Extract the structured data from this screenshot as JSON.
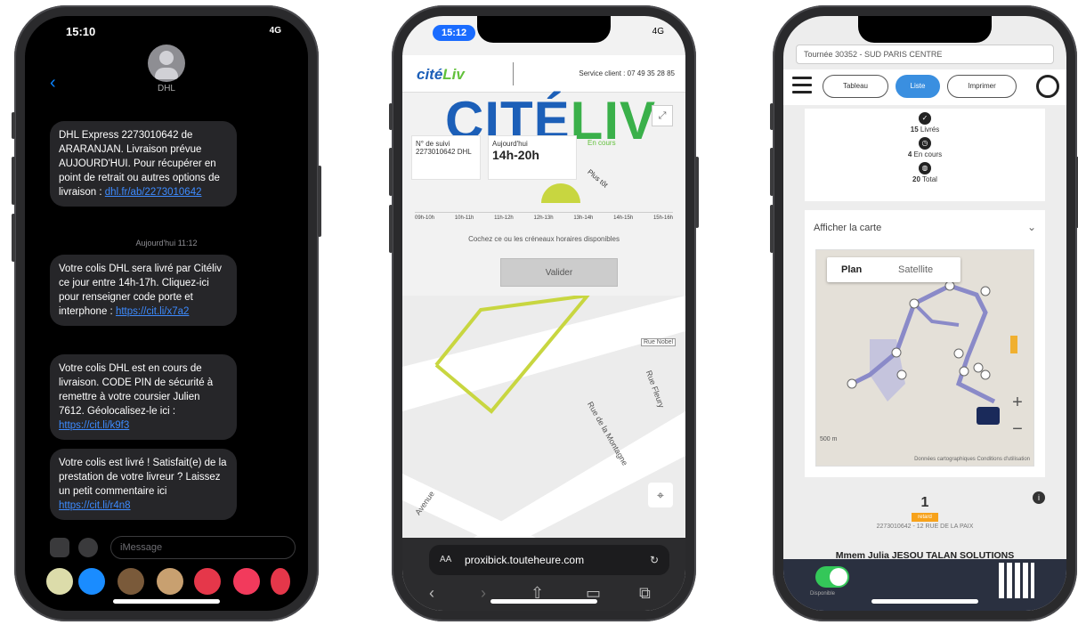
{
  "phone1": {
    "status_time": "15:10",
    "status_right": "4G",
    "contact_name": "DHL",
    "messages": [
      {
        "text": "DHL Express 2273010642 de ARARANJAN. Livraison prévue AUJOURD'HUI. Pour récupérer en point de retrait ou autres options de livraison :",
        "link": "dhl.fr/ab/2273010642"
      },
      {
        "text": "Votre colis DHL sera livré par Citéliv ce jour entre 14h-17h. Cliquez-ici pour renseigner code porte et interphone :",
        "link": "https://cit.li/x7a2"
      },
      {
        "text": "Votre colis DHL est en cours de livraison. CODE PIN de sécurité à remettre à votre coursier Julien 7612. Géolocalisez-le ici :",
        "link": "https://cit.li/k9f3"
      },
      {
        "text": "Votre colis est livré ! Satisfait(e) de la prestation de votre livreur ? Laissez un petit commentaire ici",
        "link": "https://cit.li/r4n8"
      }
    ],
    "timestamp": "Aujourd'hui 11:12",
    "compose_placeholder": "iMessage"
  },
  "phone2": {
    "status_time": "15:12",
    "status_right": "4G",
    "header_logo_a": "cité",
    "header_logo_b": "Liv",
    "service_label": "Service client : 07 49 35 28 85",
    "big_logo_a": "CITÉ",
    "big_logo_b": "LIV",
    "order_label": "N° de suivi",
    "order_value": "2273010642 DHL",
    "eta_label": "Aujourd'hui",
    "eta_value": "14h-20h",
    "status_chip": "En cours",
    "gauge_label": "Plus tôt",
    "hours": [
      "09h-10h",
      "10h-11h",
      "11h-12h",
      "12h-13h",
      "13h-14h",
      "14h-15h",
      "15h-16h"
    ],
    "info_text": "Cochez ce ou les créneaux horaires disponibles",
    "validate_label": "Valider",
    "streets": [
      "Rue de la Montagne",
      "Rue Fleury",
      "Rue Nobel",
      "Avenue"
    ],
    "url": "proxibick.touteheure.com",
    "url_prefix": "AA"
  },
  "phone3": {
    "select_value": "Tournée 30352 - SUD PARIS CENTRE",
    "nav_buttons": [
      "Tableau",
      "Liste",
      "Imprimer"
    ],
    "stats": [
      {
        "count": "15",
        "label": "Livrés"
      },
      {
        "count": "4",
        "label": "En cours"
      },
      {
        "count": "20",
        "label": "Total"
      }
    ],
    "map_title": "Afficher la carte",
    "map_tabs": [
      "Plan",
      "Satellite"
    ],
    "map_scale": "500 m",
    "map_attribution": "Données cartographiques   Conditions d'utilisation",
    "stop_number": "1",
    "stop_tag": "retard",
    "stop_address": "2273010642 - 12 RUE DE LA PAIX",
    "stop_name": "Mmem Julia JESOU TALAN SOLUTIONS",
    "toggle_label": "Disponible"
  }
}
